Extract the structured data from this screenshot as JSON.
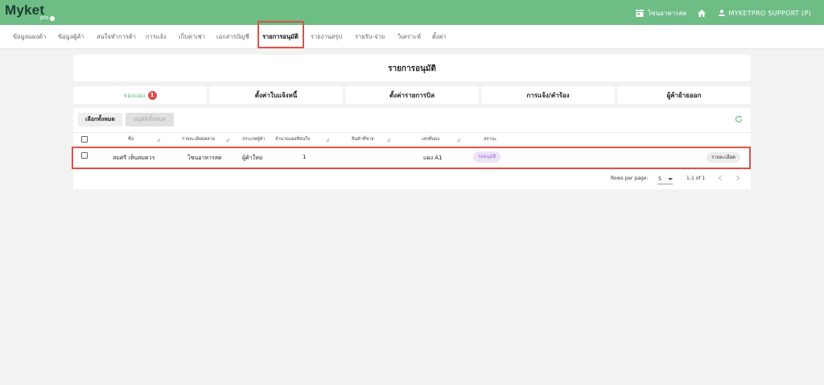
{
  "brand": {
    "name": "Myket",
    "sub": "pro"
  },
  "topbar": {
    "store_name": "โซนอาหารสด",
    "user_name": "MYKETPRO SUPPORT (P)"
  },
  "nav": {
    "items": [
      {
        "label": "ข้อมูลแผงค้า"
      },
      {
        "label": "ข้อมูลผู้ค้า"
      },
      {
        "label": "สนใจทำการค้า"
      },
      {
        "label": "การแจ้ง"
      },
      {
        "label": "เก็บค่าเช่า"
      },
      {
        "label": "เอกสารบัญชี"
      },
      {
        "label": "รายการอนุมัติ"
      },
      {
        "label": "รายงานสรุป"
      },
      {
        "label": "รายรับ-จ่าย"
      },
      {
        "label": "วิเคราะห์"
      },
      {
        "label": "ตั้งค่า"
      }
    ],
    "active_index": 6
  },
  "page": {
    "title": "รายการอนุมัติ"
  },
  "tabs": [
    {
      "label": "จองแผง",
      "badge": "1"
    },
    {
      "label": "ตั้งค่าใบแจ้งหนี้"
    },
    {
      "label": "ตั้งค่ารายการบิล"
    },
    {
      "label": "การแจ้ง/คำร้อง"
    },
    {
      "label": "ผู้ค้าย้ายออก"
    }
  ],
  "toolbar": {
    "select_all": "เลือกทั้งหมด",
    "approve_all": "อนุมัติทั้งหมด"
  },
  "table": {
    "headers": [
      "ชื่อ",
      "รายละเอียดตลาด",
      "ประเภทผู้ค้า",
      "จำนวนแผงที่สนใจ",
      "สินค้าที่ขาย",
      "เลขที่แผง",
      "สถานะ"
    ],
    "rows": [
      {
        "name": "สมศรี เห็นสมควร",
        "market": "โซนอาหารสด",
        "vendor_type": "ผู้ค้าใหม่",
        "stall_count": "1",
        "goods": "",
        "stall_no": "แผง A1",
        "status": "รออนุมัติ",
        "action": "รายละเอียด"
      }
    ]
  },
  "pagination": {
    "rows_label": "Rows per page:",
    "rows_value": "5",
    "range": "1-1 of 1"
  },
  "colors": {
    "topbar": "#6dbd85",
    "highlight": "#d9544a",
    "badge": "#e04a4a",
    "status_bg": "#ede4f8",
    "status_fg": "#9a6bd0"
  }
}
